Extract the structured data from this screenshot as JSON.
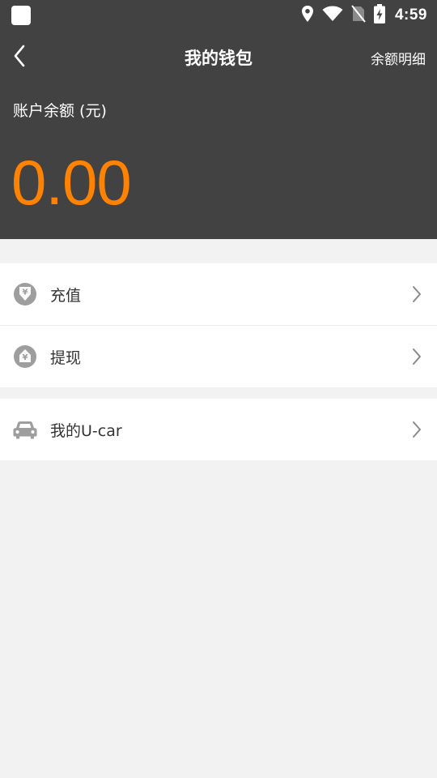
{
  "status_bar": {
    "time": "4:59",
    "icons": [
      "app-notification-icon",
      "location-icon",
      "wifi-icon",
      "no-sim-icon",
      "battery-charging-icon"
    ]
  },
  "header": {
    "back_icon": "chevron-left-icon",
    "title": "我的钱包",
    "right_link": "余额明细",
    "balance_label": "账户余额 (元)",
    "balance_value": "0.00"
  },
  "colors": {
    "header_bg": "#424242",
    "accent": "#ff8200",
    "page_bg": "#f2f2f2",
    "icon_gray": "#9e9e9e"
  },
  "menu": {
    "group1": [
      {
        "label": "充值",
        "icon": "yen-arrow-down-icon"
      },
      {
        "label": "提现",
        "icon": "yen-arrow-up-icon"
      }
    ],
    "group2": [
      {
        "label": "我的U-car",
        "icon": "car-icon"
      }
    ]
  }
}
